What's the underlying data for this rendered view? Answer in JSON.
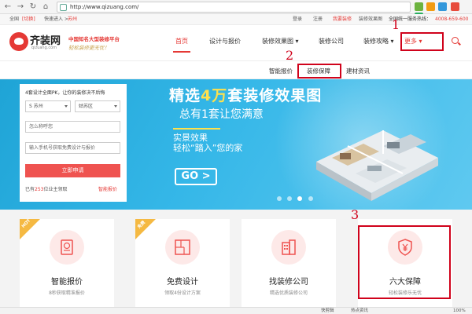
{
  "browser": {
    "url": "http://www.qizuang.com/"
  },
  "topbar": {
    "region": "全国",
    "switch": "[切换]",
    "quick_entry": "快速进入 >",
    "city": "苏州",
    "login": "登录",
    "register": "注册",
    "want_renovate": "我要装修",
    "effect_pics": "装修效果图",
    "hotline": "全国统一服务热线：",
    "hotline_number": "4008-659-600"
  },
  "header": {
    "logo_name": "齐装网",
    "logo_domain": "qizuang.com",
    "slogan_main": "中国知名大型装修平台",
    "slogan_sub": "轻松装修更无忧！",
    "nav": [
      "首页",
      "设计与报价",
      "装修效果图",
      "装修公司",
      "装修攻略",
      "更多"
    ]
  },
  "submenu": {
    "items": [
      "智能报价",
      "装修保障",
      "建材资讯"
    ]
  },
  "annotations": [
    "1",
    "2",
    "3"
  ],
  "banner": {
    "title_pre": "精选",
    "title_hl": "4万",
    "title_post": "套装修效果图",
    "subtitle": "总有1套让您满意",
    "tagline1": "实景效果",
    "tagline2": "轻松“踏入”您的家",
    "go": "GO >"
  },
  "form": {
    "title": "4套设计全面PK，让你的装修决不后悔",
    "province": "S 苏州",
    "district": "姑苏区",
    "name_placeholder": "怎么称呼您",
    "phone_placeholder": "输入手机号获取免费设计与报价",
    "submit": "立即申请",
    "note_pre": "已有",
    "note_count": "253",
    "note_post": "位业主领取",
    "link": "智能报价"
  },
  "cards": [
    {
      "title": "智能报价",
      "desc": "8秒获取精准报价",
      "tag": "HOT"
    },
    {
      "title": "免费设计",
      "desc": "领取4份设计方案",
      "tag": "免费"
    },
    {
      "title": "找装修公司",
      "desc": "精选优质装修公司",
      "tag": ""
    },
    {
      "title": "六大保障",
      "desc": "轻松装修乐无忧",
      "tag": ""
    }
  ],
  "statusbar": {
    "quick": "快剪辑",
    "news": "热点资讯",
    "zoom": "100%"
  },
  "colors": {
    "brand_red": "#e53935",
    "banner_blue": "#35b7e8",
    "annotation_red": "#d0021b"
  }
}
